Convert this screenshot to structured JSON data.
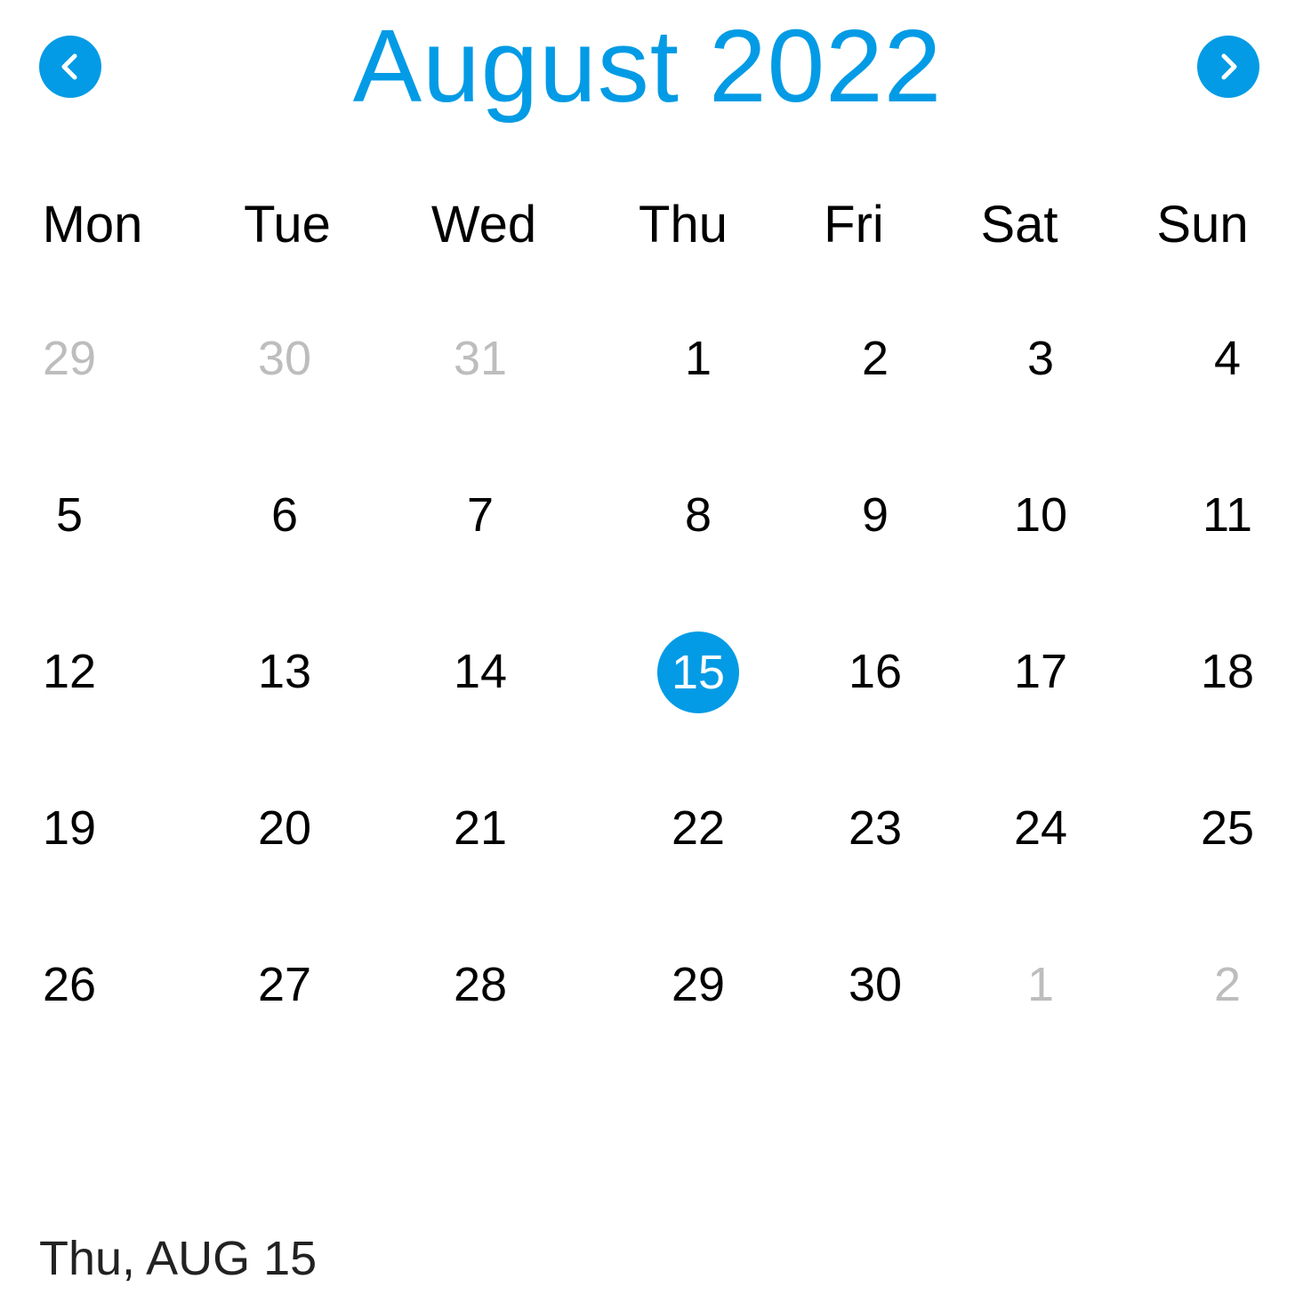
{
  "colors": {
    "accent": "#039BE5",
    "muted": "#BDBDBD",
    "text": "#000000"
  },
  "header": {
    "title": "August 2022",
    "prev_icon": "chevron-left-icon",
    "next_icon": "chevron-right-icon"
  },
  "weekdays": [
    "Mon",
    "Tue",
    "Wed",
    "Thu",
    "Fri",
    "Sat",
    "Sun"
  ],
  "weeks": [
    [
      {
        "d": "29",
        "m": true
      },
      {
        "d": "30",
        "m": true
      },
      {
        "d": "31",
        "m": true
      },
      {
        "d": "1"
      },
      {
        "d": "2"
      },
      {
        "d": "3"
      },
      {
        "d": "4"
      }
    ],
    [
      {
        "d": "5"
      },
      {
        "d": "6"
      },
      {
        "d": "7"
      },
      {
        "d": "8"
      },
      {
        "d": "9"
      },
      {
        "d": "10"
      },
      {
        "d": "11"
      }
    ],
    [
      {
        "d": "12"
      },
      {
        "d": "13"
      },
      {
        "d": "14"
      },
      {
        "d": "15",
        "sel": true
      },
      {
        "d": "16"
      },
      {
        "d": "17"
      },
      {
        "d": "18"
      }
    ],
    [
      {
        "d": "19"
      },
      {
        "d": "20"
      },
      {
        "d": "21"
      },
      {
        "d": "22"
      },
      {
        "d": "23"
      },
      {
        "d": "24"
      },
      {
        "d": "25"
      }
    ],
    [
      {
        "d": "26"
      },
      {
        "d": "27"
      },
      {
        "d": "28"
      },
      {
        "d": "29"
      },
      {
        "d": "30"
      },
      {
        "d": "1",
        "m": true
      },
      {
        "d": "2",
        "m": true
      }
    ]
  ],
  "selected_date_label": "Thu, AUG 15"
}
